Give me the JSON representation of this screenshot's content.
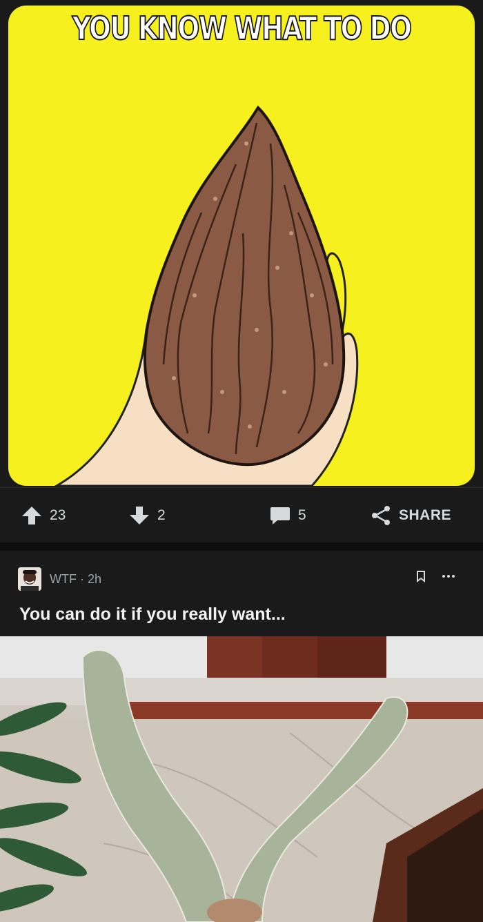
{
  "post1": {
    "meme_caption": "YOU KNOW WHAT TO DO",
    "upvotes": "23",
    "downvotes": "2",
    "comments": "5",
    "share_label": "SHARE"
  },
  "post2": {
    "community": "WTF",
    "time": "2h",
    "meta_line": "WTF · 2h",
    "title": "You can do it if you really want..."
  },
  "colors": {
    "background": "#1a1a1b",
    "meme_yellow": "#f5f01e",
    "text": "#d7dadc",
    "muted": "#9ea3a6"
  }
}
